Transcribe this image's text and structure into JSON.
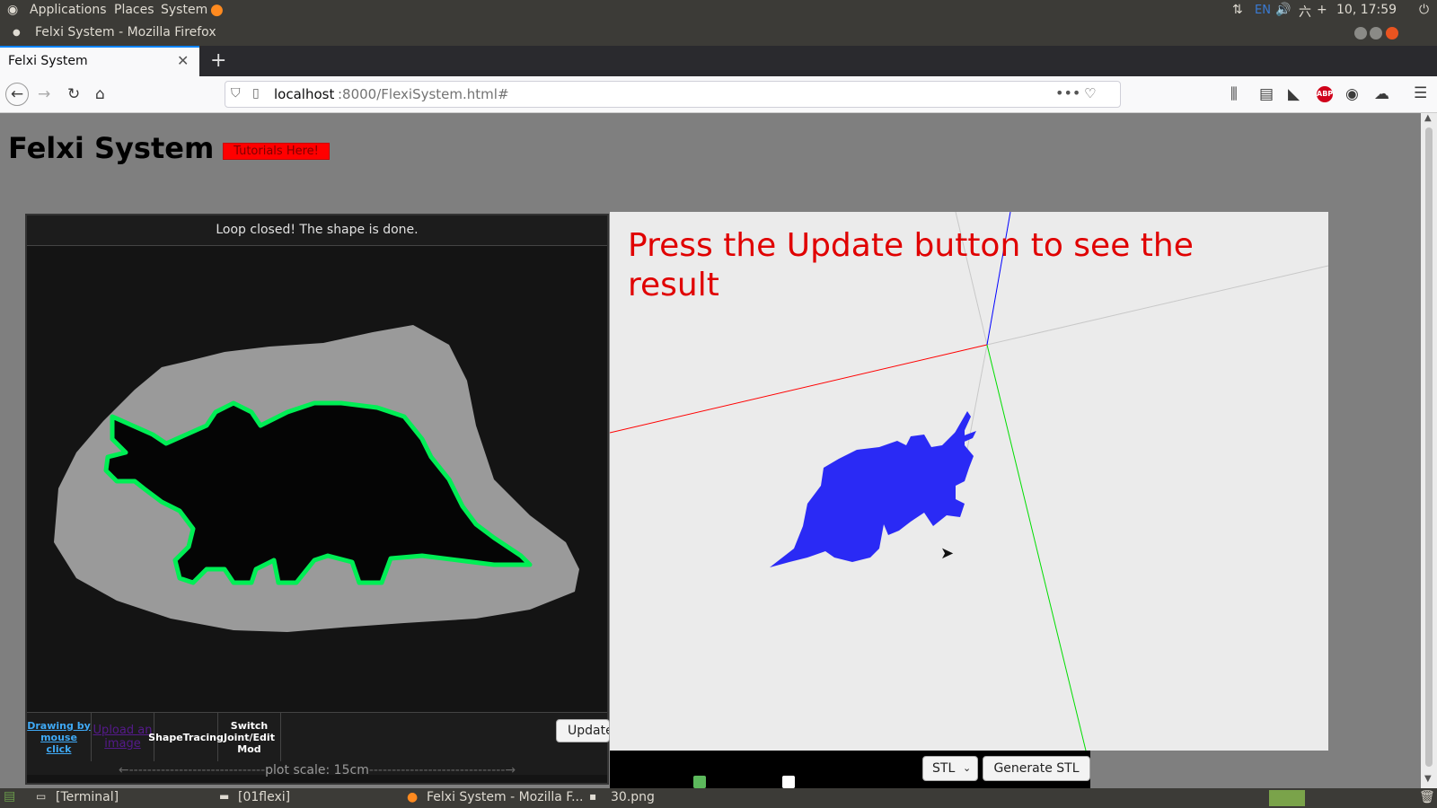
{
  "panel": {
    "menus": [
      "Applications",
      "Places",
      "System"
    ],
    "keyboard": "EN",
    "clock": "10, 17:59"
  },
  "window": {
    "title": "Felxi System - Mozilla Firefox"
  },
  "browser": {
    "tab_title": "Felxi System",
    "url_host": "localhost",
    "url_rest": ":8000/FlexiSystem.html#"
  },
  "page": {
    "heading": "Felxi System",
    "tutorial_button": "Tutorials Here!"
  },
  "canvas": {
    "status": "Loop closed! The shape is done.",
    "tools": [
      "Drawing by mouse click",
      "Upload an image",
      "ShapeTracing",
      "Switch Joint/Edit Mod"
    ],
    "scale_label": "plot scale: 15cm",
    "update_button": "Update"
  },
  "viewer": {
    "message": "Press the Update button to see the result",
    "format_selected": "STL",
    "generate_button": "Generate STL"
  },
  "taskbar": {
    "items": [
      "[Terminal]",
      "[01flexi]",
      "Felxi System - Mozilla F...",
      "30.png"
    ]
  },
  "colors": {
    "outline": "#00ee55",
    "model": "#2a2af5",
    "axis_x": "#ff0000",
    "axis_y": "#00dd00",
    "axis_z": "#0000ff"
  }
}
